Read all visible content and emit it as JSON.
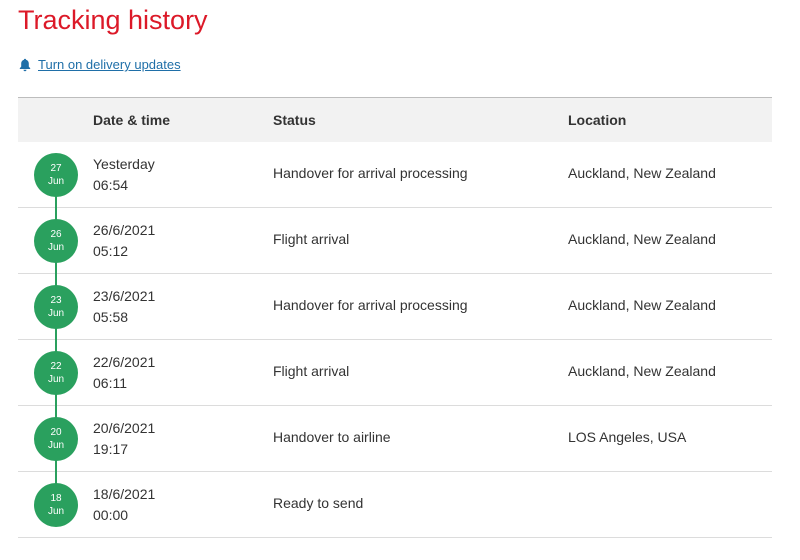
{
  "title": "Tracking history",
  "delivery_updates": {
    "label": "Turn on delivery updates",
    "icon": "bell-icon"
  },
  "table": {
    "headers": {
      "date_time": "Date & time",
      "status": "Status",
      "location": "Location"
    },
    "rows": [
      {
        "day": "27",
        "month": "Jun",
        "date": "Yesterday",
        "time": "06:54",
        "status": "Handover for arrival processing",
        "location": "Auckland, New Zealand"
      },
      {
        "day": "26",
        "month": "Jun",
        "date": "26/6/2021",
        "time": "05:12",
        "status": "Flight arrival",
        "location": "Auckland, New Zealand"
      },
      {
        "day": "23",
        "month": "Jun",
        "date": "23/6/2021",
        "time": "05:58",
        "status": "Handover for arrival processing",
        "location": "Auckland, New Zealand"
      },
      {
        "day": "22",
        "month": "Jun",
        "date": "22/6/2021",
        "time": "06:11",
        "status": "Flight arrival",
        "location": "Auckland, New Zealand"
      },
      {
        "day": "20",
        "month": "Jun",
        "date": "20/6/2021",
        "time": "19:17",
        "status": "Handover to airline",
        "location": "LOS Angeles, USA"
      },
      {
        "day": "18",
        "month": "Jun",
        "date": "18/6/2021",
        "time": "00:00",
        "status": "Ready to send",
        "location": ""
      }
    ]
  },
  "colors": {
    "title": "#dc1928",
    "link": "#1f6fa8",
    "badge": "#2aa05e",
    "header_bg": "#f2f2f2"
  }
}
